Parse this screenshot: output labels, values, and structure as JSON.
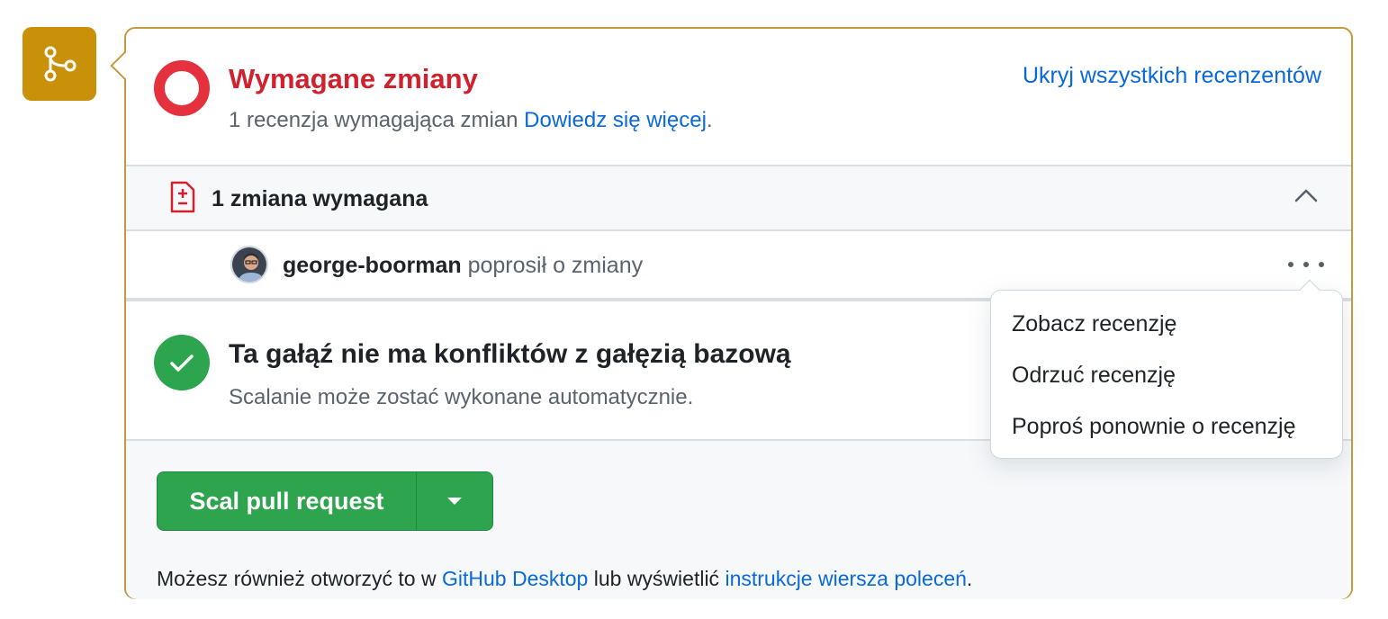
{
  "colors": {
    "merge_icon_bg": "#c9910a",
    "danger": "#cf222e",
    "success": "#2ea44f",
    "link": "#0969da"
  },
  "icons": {
    "merge_box": "git-merge-icon",
    "review_status": "changes-requested-circle-icon",
    "changes": "file-diff-icon",
    "collapse": "chevron-up-icon",
    "more": "kebab-horizontal-icon",
    "merge_status": "check-circle-icon",
    "split_button": "triangle-down-icon"
  },
  "review": {
    "title": "Wymagane zmiany",
    "summary": "1 recenzja wymagająca zmian",
    "learn_more": "Dowiedz się więcej",
    "punctuation": ".",
    "hide_reviewers": "Ukryj wszystkich recenzentów"
  },
  "changes": {
    "label": "1 zmiana wymagana",
    "reviewer": {
      "name": "george-boorman",
      "action": "poprosił o zmiany"
    }
  },
  "merge_status": {
    "title": "Ta gałąź nie ma konfliktów z gałęzią bazową",
    "subtitle": "Scalanie może zostać wykonane automatycznie."
  },
  "actions": {
    "merge_button": "Scal pull request",
    "alt_prefix": "Możesz również otworzyć to w",
    "alt_desktop": "GitHub Desktop",
    "alt_middle": "lub wyświetlić",
    "alt_cli": "instrukcje wiersza poleceń",
    "alt_suffix": "."
  },
  "menu": {
    "items": [
      "Zobacz recenzję",
      "Odrzuć recenzję",
      "Poproś ponownie o recenzję"
    ]
  }
}
